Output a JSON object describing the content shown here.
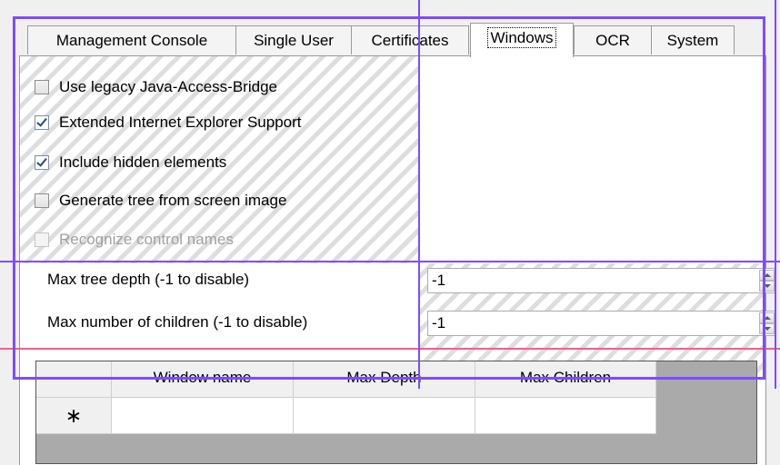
{
  "tabs": [
    {
      "label": "Management Console",
      "active": false
    },
    {
      "label": "Single User",
      "active": false
    },
    {
      "label": "Certificates",
      "active": false
    },
    {
      "label": "Windows",
      "active": true
    },
    {
      "label": "OCR",
      "active": false
    },
    {
      "label": "System",
      "active": false
    }
  ],
  "options": [
    {
      "label": "Use legacy Java-Access-Bridge",
      "checked": false,
      "enabled": true
    },
    {
      "label": "Extended Internet Explorer Support",
      "checked": true,
      "enabled": true
    },
    {
      "label": "Include hidden elements",
      "checked": true,
      "enabled": true
    },
    {
      "label": "Generate tree from screen image",
      "checked": false,
      "enabled": true
    },
    {
      "label": "Recognize control names",
      "checked": false,
      "enabled": false
    }
  ],
  "fields": {
    "max_tree_depth": {
      "label": "Max tree depth (-1 to disable)",
      "value": "-1"
    },
    "max_children": {
      "label": "Max number of children (-1 to disable)",
      "value": "-1"
    }
  },
  "grid": {
    "columns": [
      "Window name",
      "Max Depth",
      "Max Children"
    ],
    "new_row_marker": "∗"
  },
  "colors": {
    "overlay": "#7d4cff",
    "overlay_secondary": "#ff5a8a"
  }
}
